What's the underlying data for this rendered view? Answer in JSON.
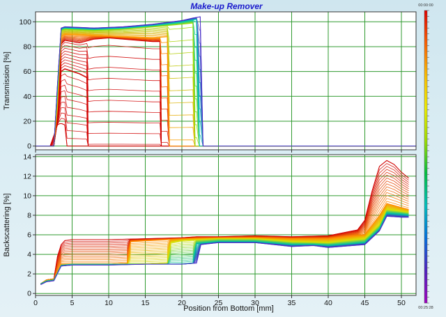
{
  "chart_data": {
    "type": "line",
    "title": "Make-up Remover",
    "xlabel": "Position from Bottom [mm]",
    "x_ticks": [
      "0",
      "5",
      "10",
      "15",
      "20",
      "25",
      "30",
      "35",
      "40",
      "45",
      "50"
    ],
    "xlim": [
      0,
      52
    ],
    "grid": true,
    "colorbar": {
      "top_label": "00:00:00",
      "bottom_label": "00:25:28",
      "colors": [
        "#e00000",
        "#ff6000",
        "#ffc000",
        "#f0f000",
        "#a0e000",
        "#00c040",
        "#00c0c0",
        "#0070e0",
        "#5020c0",
        "#a000c0"
      ]
    },
    "panels": [
      {
        "name": "transmission",
        "ylabel": "Transmission [%]",
        "y_ticks": [
          "0",
          "20",
          "40",
          "60",
          "80",
          "100"
        ],
        "ylim": [
          -3,
          108
        ],
        "curve_count": 60,
        "series": [
          {
            "name": "",
            "color": "#d00000",
            "x": [
              0,
              2.0,
              3.0,
              3.3,
              3.6,
              4.0,
              4.3,
              25,
              52
            ],
            "y": [
              0,
              0,
              17,
              18,
              18,
              17,
              0,
              0,
              0
            ]
          },
          {
            "name": "",
            "color": "#d00000",
            "x": [
              0,
              2.5,
              3.0,
              3.5,
              4.0,
              5.0,
              6.0,
              7.0,
              7.2,
              25,
              52
            ],
            "y": [
              0,
              0,
              20,
              60,
              62,
              60,
              58,
              55,
              0,
              0,
              0
            ]
          },
          {
            "name": "",
            "color": "#d00000",
            "x": [
              0,
              2.5,
              3.0,
              3.5,
              4.0,
              6.0,
              8.0,
              10.0,
              12.0,
              14.0,
              16.0,
              17.0,
              17.2,
              25,
              52
            ],
            "y": [
              0,
              0,
              25,
              82,
              85,
              83,
              86,
              87,
              86,
              85,
              84,
              84,
              0,
              0,
              0
            ]
          },
          {
            "name": "",
            "color": "#ff9a00",
            "x": [
              0,
              2.5,
              3.0,
              3.5,
              4.0,
              8.0,
              12.0,
              16.0,
              18.0,
              18.3,
              25,
              52
            ],
            "y": [
              0,
              0,
              30,
              88,
              90,
              89,
              88,
              87,
              88,
              0,
              0,
              0
            ]
          },
          {
            "name": "",
            "color": "#9cdc00",
            "x": [
              0,
              2.5,
              3.0,
              3.5,
              4.0,
              8.0,
              12.0,
              16.0,
              20.0,
              21.5,
              21.8,
              25,
              52
            ],
            "y": [
              0,
              0,
              40,
              93,
              94,
              93,
              94,
              96,
              98,
              99,
              0,
              0,
              0
            ]
          },
          {
            "name": "",
            "color": "#00c8b0",
            "x": [
              0,
              2.5,
              3.0,
              3.5,
              4.0,
              8.0,
              12.0,
              16.0,
              20.0,
              22.0,
              22.4,
              25,
              52
            ],
            "y": [
              0,
              0,
              45,
              94,
              95,
              94,
              95,
              97,
              100,
              102,
              0,
              0,
              0
            ]
          },
          {
            "name": "",
            "color": "#4a2cc8",
            "x": [
              0,
              2.5,
              3.0,
              3.5,
              4.0,
              8.0,
              12.0,
              16.0,
              20.0,
              21.5,
              22.5,
              22.9,
              25,
              52
            ],
            "y": [
              0,
              0,
              50,
              95,
              96,
              95,
              96,
              98,
              101,
              103,
              104,
              0,
              0,
              0
            ]
          }
        ]
      },
      {
        "name": "backscattering",
        "ylabel": "Backscattering [%]",
        "y_ticks": [
          "0",
          "2",
          "4",
          "6",
          "8",
          "10",
          "12",
          "14"
        ],
        "ylim": [
          -0.2,
          14.2
        ],
        "curve_count": 60,
        "series": [
          {
            "name": "",
            "color": "#d00000",
            "x": [
              0.7,
              1.5,
              2.5,
              3.0,
              3.5,
              4.0,
              5.0,
              10.0,
              15.0,
              20.0,
              22.0,
              25.0,
              30.0,
              35.0,
              40.0,
              44.0,
              45.0,
              46.0,
              47.0,
              48.0,
              49.0,
              50.0,
              51.0
            ],
            "y": [
              1.0,
              1.4,
              1.5,
              3.8,
              5.0,
              5.4,
              5.5,
              5.5,
              5.6,
              5.7,
              5.8,
              5.8,
              5.9,
              5.8,
              5.9,
              6.5,
              7.5,
              10.5,
              13.0,
              13.6,
              13.2,
              12.4,
              11.8
            ]
          },
          {
            "name": "",
            "color": "#ff8c00",
            "x": [
              0.7,
              1.5,
              2.5,
              3.5,
              5.0,
              10.0,
              12.5,
              13.0,
              15.0,
              20.0,
              25.0,
              30.0,
              35.0,
              40.0,
              45.0,
              47.0,
              48.0,
              49.0,
              50.0,
              51.0
            ],
            "y": [
              1.0,
              1.4,
              1.5,
              3.0,
              3.0,
              3.0,
              3.1,
              5.3,
              5.4,
              5.6,
              5.7,
              5.7,
              5.6,
              5.6,
              6.0,
              8.0,
              9.2,
              9.0,
              8.8,
              8.6
            ]
          },
          {
            "name": "",
            "color": "#d6e000",
            "x": [
              0.7,
              1.5,
              2.5,
              3.5,
              5.0,
              10.0,
              15.0,
              18.0,
              18.5,
              20.0,
              25.0,
              30.0,
              35.0,
              40.0,
              45.0,
              47.0,
              48.0,
              50.0,
              51.0
            ],
            "y": [
              1.0,
              1.3,
              1.4,
              2.9,
              3.0,
              3.0,
              3.0,
              3.1,
              5.2,
              5.4,
              5.6,
              5.6,
              5.3,
              5.2,
              5.6,
              7.0,
              8.6,
              8.4,
              8.3
            ]
          },
          {
            "name": "",
            "color": "#00c0a0",
            "x": [
              0.7,
              1.5,
              2.5,
              3.5,
              5.0,
              10.0,
              15.0,
              20.0,
              21.5,
              22.0,
              25.0,
              30.0,
              35.0,
              38.0,
              40.0,
              45.0,
              47.0,
              48.0,
              50.0,
              51.0
            ],
            "y": [
              1.0,
              1.3,
              1.4,
              2.9,
              3.0,
              3.0,
              3.0,
              3.0,
              3.1,
              5.1,
              5.3,
              5.3,
              5.0,
              5.0,
              4.9,
              5.2,
              6.6,
              8.2,
              8.1,
              8.0
            ]
          },
          {
            "name": "",
            "color": "#4a2cc8",
            "x": [
              0.7,
              1.5,
              2.5,
              3.5,
              5.0,
              10.0,
              15.0,
              20.0,
              22.0,
              22.6,
              25.0,
              30.0,
              35.0,
              38.0,
              40.0,
              45.0,
              47.0,
              48.0,
              50.0,
              51.0
            ],
            "y": [
              0.9,
              1.2,
              1.3,
              2.8,
              2.9,
              2.9,
              3.0,
              3.0,
              3.1,
              5.0,
              5.2,
              5.2,
              4.8,
              4.9,
              4.7,
              5.0,
              6.4,
              7.9,
              7.8,
              7.8
            ]
          }
        ]
      }
    ]
  }
}
